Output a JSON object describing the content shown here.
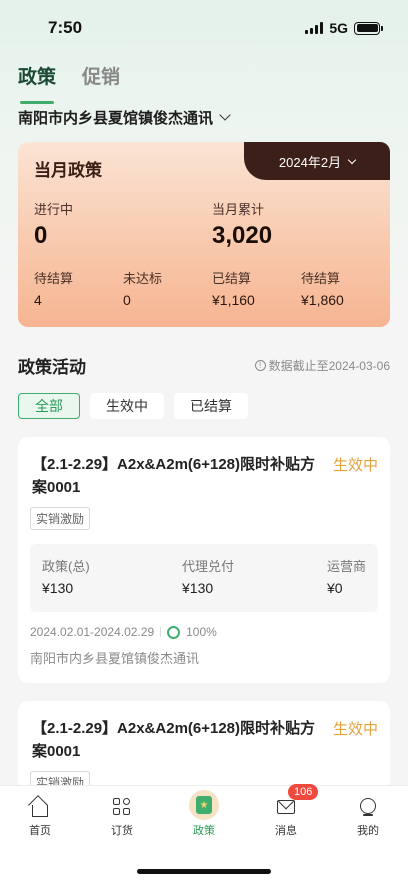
{
  "status_bar": {
    "time": "7:50",
    "network": "5G"
  },
  "top_tabs": [
    {
      "label": "政策",
      "active": true
    },
    {
      "label": "促销",
      "active": false
    }
  ],
  "store": {
    "name": "南阳市内乡县夏馆镇俊杰通讯"
  },
  "month_card": {
    "title": "当月政策",
    "month": "2024年2月",
    "in_progress": {
      "label": "进行中",
      "value": "0"
    },
    "month_total": {
      "label": "当月累计",
      "value": "3,020"
    },
    "stats": [
      {
        "label": "待结算",
        "value": "4"
      },
      {
        "label": "未达标",
        "value": "0"
      },
      {
        "label": "已结算",
        "value": "¥1,160"
      },
      {
        "label": "待结算",
        "value": "¥1,860"
      }
    ]
  },
  "activity": {
    "title": "政策活动",
    "note": "数据截止至2024-03-06",
    "filters": [
      {
        "label": "全部",
        "active": true
      },
      {
        "label": "生效中",
        "active": false
      },
      {
        "label": "已结算",
        "active": false
      }
    ]
  },
  "policies": [
    {
      "title": "【2.1-2.29】A2x&A2m(6+128)限时补贴方案0001",
      "status": "生效中",
      "tag": "实销激励",
      "stats": [
        {
          "label": "政策(总)",
          "value": "¥130"
        },
        {
          "label": "代理兑付",
          "value": "¥130"
        },
        {
          "label": "运营商",
          "value": "¥0"
        }
      ],
      "date_range": "2024.02.01-2024.02.29",
      "progress": "100%",
      "store": "南阳市内乡县夏馆镇俊杰通讯"
    },
    {
      "title": "【2.1-2.29】A2x&A2m(6+128)限时补贴方案0001",
      "status": "生效中",
      "tag": "实销激励"
    }
  ],
  "bottom_nav": [
    {
      "label": "首页",
      "icon": "home-icon"
    },
    {
      "label": "订货",
      "icon": "grid-icon"
    },
    {
      "label": "政策",
      "icon": "policy-icon",
      "active": true
    },
    {
      "label": "消息",
      "icon": "mail-icon",
      "badge": "106"
    },
    {
      "label": "我的",
      "icon": "user-icon"
    }
  ],
  "colors": {
    "accent": "#3fae6d",
    "status_active": "#e3a23b",
    "card_dark": "#3d1f1a",
    "badge": "#f0493d"
  }
}
